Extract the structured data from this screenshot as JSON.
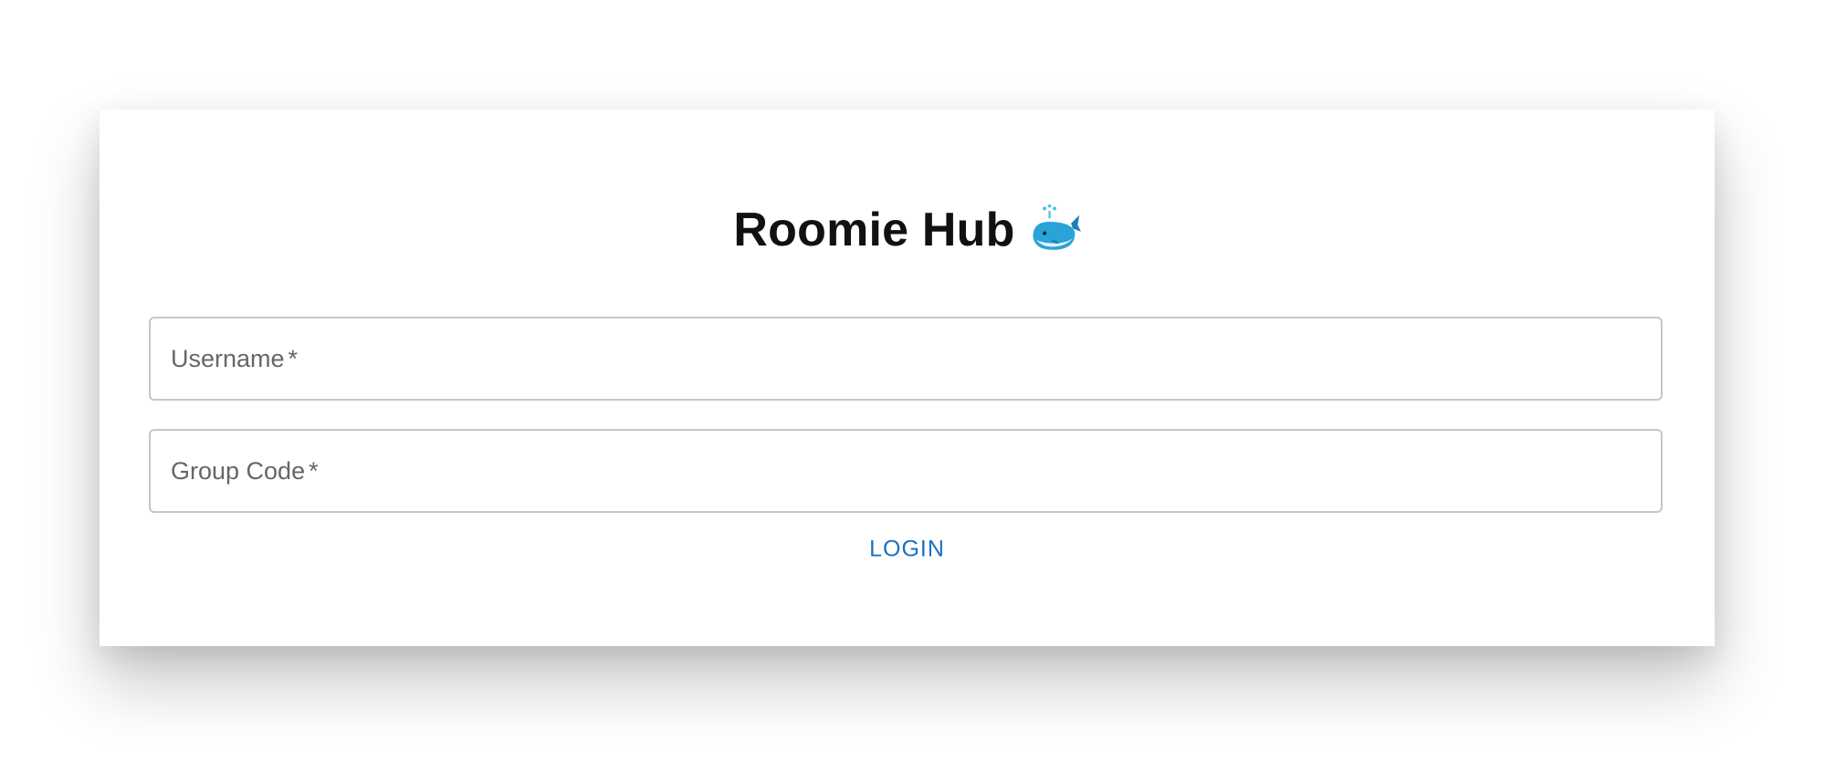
{
  "app": {
    "title": "Roomie Hub",
    "title_icon": "whale-icon"
  },
  "form": {
    "username": {
      "label": "Username",
      "required_mark": "*",
      "value": ""
    },
    "group_code": {
      "label": "Group Code",
      "required_mark": "*",
      "value": ""
    },
    "login_label": "LOGIN"
  },
  "colors": {
    "accent": "#1a6fc4",
    "field_border": "#c6c6c6",
    "label": "#666666",
    "title": "#111111",
    "whale": "#29a3d8"
  }
}
